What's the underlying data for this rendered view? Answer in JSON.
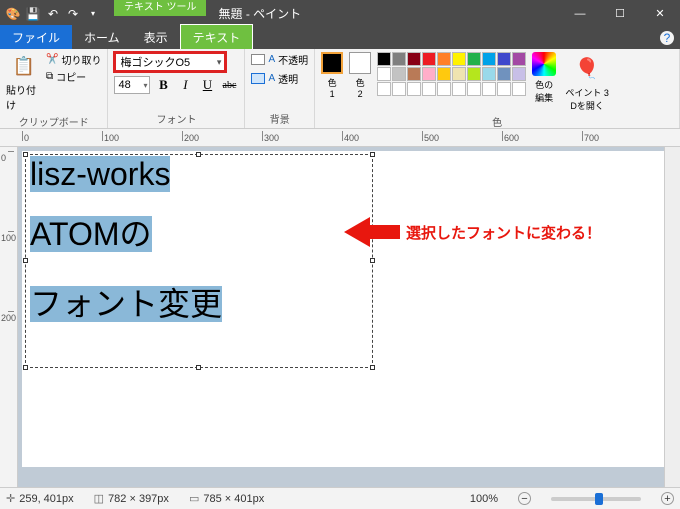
{
  "titlebar": {
    "tool_tab": "テキスト ツール",
    "title": "無題 - ペイント"
  },
  "tabs": {
    "file": "ファイル",
    "home": "ホーム",
    "view": "表示",
    "text": "テキスト"
  },
  "ribbon": {
    "clipboard": {
      "paste": "貼り付け",
      "cut": "切り取り",
      "copy": "コピー",
      "label": "クリップボード"
    },
    "font": {
      "name": "梅ゴシックO5",
      "size": "48",
      "label": "フォント"
    },
    "background": {
      "opaque": "不透明",
      "transparent": "透明",
      "label": "背景"
    },
    "colors": {
      "color1": "色\n1",
      "color2": "色\n2",
      "edit": "色の\n編集",
      "label": "色",
      "palette": [
        "#000000",
        "#7f7f7f",
        "#880015",
        "#ed1c24",
        "#ff7f27",
        "#fff200",
        "#22b14c",
        "#00a2e8",
        "#3f48cc",
        "#a349a4",
        "#ffffff",
        "#c3c3c3",
        "#b97a57",
        "#ffaec9",
        "#ffc90e",
        "#efe4b0",
        "#b5e61d",
        "#99d9ea",
        "#7092be",
        "#c8bfe7",
        "#ffffff",
        "#ffffff",
        "#ffffff",
        "#ffffff",
        "#ffffff",
        "#ffffff",
        "#ffffff",
        "#ffffff",
        "#ffffff",
        "#ffffff"
      ]
    },
    "paint3d": "ペイント 3\nDを開く"
  },
  "ruler_h": [
    0,
    100,
    200,
    300,
    400,
    500,
    600,
    700
  ],
  "ruler_v": [
    0,
    100,
    200
  ],
  "canvas": {
    "line1": "lisz-works",
    "line2": "ATOMの",
    "line3": "フォント変更"
  },
  "annotation": "選択したフォントに変わる！",
  "status": {
    "cursor": "259, 401px",
    "selection": "782 × 397px",
    "canvas_size": "785 × 401px",
    "zoom": "100%"
  }
}
